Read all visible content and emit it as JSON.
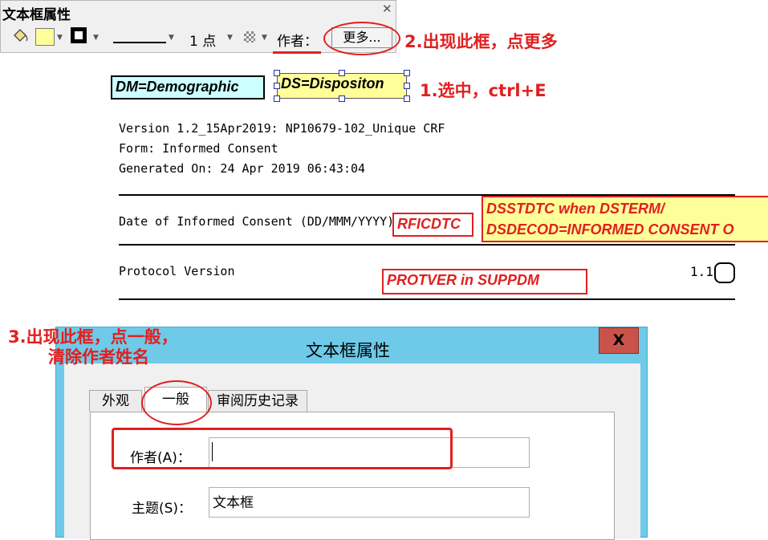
{
  "toolbar": {
    "title": "文本框属性",
    "close_glyph": "✕",
    "fill_color": "#ffff99",
    "stroke_color": "#000000",
    "line_width_label": "1 点",
    "author_label": "作者：",
    "more_button_label": "更多..."
  },
  "steps": {
    "step1": "1.选中，ctrl+E",
    "step2": "2.出现此框，点更多",
    "step3_line1": "3.出现此框，点一般，",
    "step3_line2": "清除作者姓名"
  },
  "document": {
    "dm_label": "DM=Demographic",
    "ds_label": "DS=Dispositon",
    "header_lines": [
      "Version 1.2_15Apr2019: NP10679-102_Unique CRF",
      "Form: Informed Consent",
      "Generated On: 24 Apr 2019 06:43:04"
    ],
    "consent_date_label": "Date of Informed Consent (DD/MMM/YYYY)",
    "rficdtc": "RFICDTC",
    "dsstdtc_line1": "DSSTDTC when DSTERM/",
    "dsstdtc_line2": "DSDECOD=INFORMED CONSENT O",
    "protocol_label": "Protocol Version",
    "protver": "PROTVER  in SUPPDM",
    "version_value": "1.1"
  },
  "dialog": {
    "title": "文本框属性",
    "close_glyph": "X",
    "tabs": [
      "外观",
      "一般",
      "审阅历史记录"
    ],
    "author_label": "作者(A)：",
    "author_value": "",
    "subject_label": "主题(S)：",
    "subject_value": "文本框"
  },
  "colors": {
    "annotation_red": "#e02020",
    "note_yellow": "#ffff99",
    "note_cyan": "#ccffff",
    "dialog_frame": "#6ecae8",
    "close_red": "#c9534a"
  }
}
